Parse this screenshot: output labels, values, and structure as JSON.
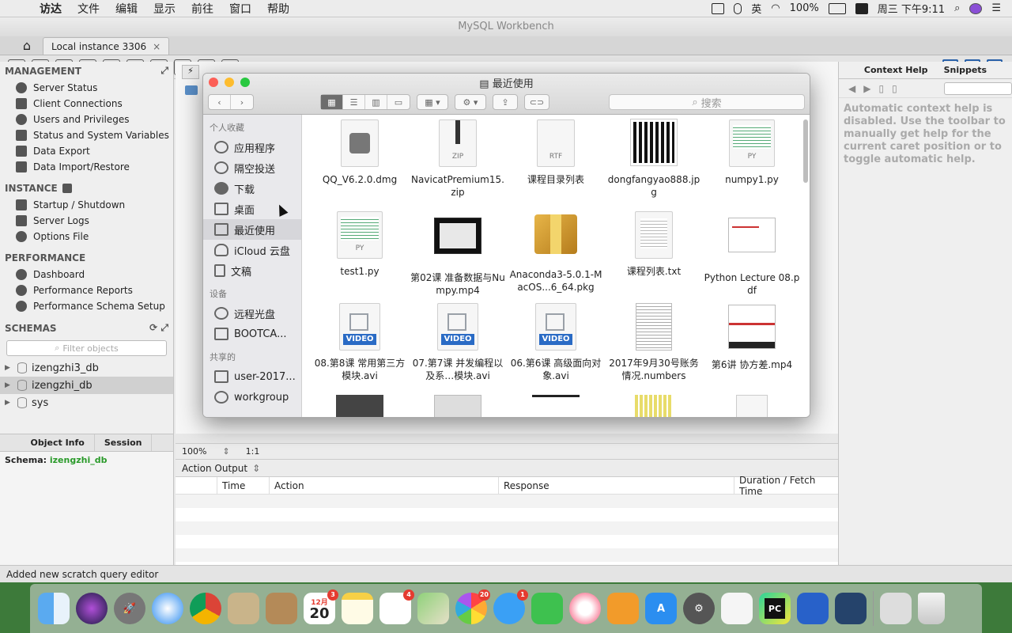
{
  "menubar": {
    "items": [
      "访达",
      "文件",
      "编辑",
      "显示",
      "前往",
      "窗口",
      "帮助"
    ],
    "right": {
      "input": "英",
      "battery": "100%",
      "datetime": "周三 下午9:11"
    }
  },
  "workbench": {
    "title": "MySQL Workbench",
    "tab_label": "Local instance 3306",
    "tab_close": "×",
    "sidebar": {
      "management_title": "MANAGEMENT",
      "management": [
        "Server Status",
        "Client Connections",
        "Users and Privileges",
        "Status and System Variables",
        "Data Export",
        "Data Import/Restore"
      ],
      "instance_title": "INSTANCE",
      "instance": [
        "Startup / Shutdown",
        "Server Logs",
        "Options File"
      ],
      "performance_title": "PERFORMANCE",
      "performance": [
        "Dashboard",
        "Performance Reports",
        "Performance Schema Setup"
      ],
      "schemas_title": "SCHEMAS",
      "filter_placeholder": "Filter objects",
      "schemas": [
        "izengzhi3_db",
        "izengzhi_db",
        "sys"
      ]
    },
    "objinfo": {
      "tab1": "Object Info",
      "tab2": "Session",
      "schema_label": "Schema:",
      "schema_value": "izengzhi_db"
    },
    "editor_strip": {
      "zoom": "100%",
      "ratio": "1:1"
    },
    "output": {
      "title": "Action Output",
      "columns": [
        "Time",
        "Action",
        "Response",
        "Duration / Fetch Time"
      ]
    },
    "rightpanel": {
      "tab1": "Context Help",
      "tab2": "Snippets",
      "help_text": "Automatic context help is disabled. Use the toolbar to manually get help for the current caret position or to toggle automatic help."
    },
    "status": "Added new scratch query editor"
  },
  "finder": {
    "title": "最近使用",
    "search_placeholder": "搜索",
    "favorites_title": "个人收藏",
    "favorites": [
      "应用程序",
      "隔空投送",
      "下载",
      "桌面",
      "最近使用",
      "iCloud 云盘",
      "文稿"
    ],
    "devices_title": "设备",
    "devices": [
      "远程光盘",
      "BOOTCA..."
    ],
    "shared_title": "共享的",
    "shared": [
      "user-2017...",
      "workgroup"
    ],
    "files": [
      {
        "name": "QQ_V6.2.0.dmg",
        "kind": "dmg"
      },
      {
        "name": "NavicatPremium15.zip",
        "kind": "zip",
        "ext": "ZIP"
      },
      {
        "name": "课程目录列表",
        "kind": "doc",
        "ext": "RTF"
      },
      {
        "name": "dongfangyao888.jpg",
        "kind": "qr"
      },
      {
        "name": "numpy1.py",
        "kind": "doc",
        "ext": "PY"
      },
      {
        "name": "test1.py",
        "kind": "doc",
        "ext": "PY"
      },
      {
        "name": "第02课 准备数据与Numpy.mp4",
        "kind": "dark"
      },
      {
        "name": "Anaconda3-5.0.1-MacOS...6_64.pkg",
        "kind": "pkg"
      },
      {
        "name": "课程列表.txt",
        "kind": "doc",
        "ext": ""
      },
      {
        "name": "Python Lecture 08.pdf",
        "kind": "pdf"
      },
      {
        "name": "08.第8课 常用第三方模块.avi",
        "kind": "video",
        "ext": "VIDEO"
      },
      {
        "name": "07.第7课 并发编程以及系…模块.avi",
        "kind": "video",
        "ext": "VIDEO"
      },
      {
        "name": "06.第6课 高级面向对象.avi",
        "kind": "video",
        "ext": "VIDEO"
      },
      {
        "name": "2017年9月30号账务情况.numbers",
        "kind": "sheet"
      },
      {
        "name": "第6讲 协方差.mp4",
        "kind": "slide"
      }
    ]
  },
  "dock": {
    "calendar_month": "12月",
    "calendar_day": "20",
    "badges": {
      "calendar": "3",
      "reminders": "4",
      "photos": "20",
      "messages": "1"
    }
  }
}
